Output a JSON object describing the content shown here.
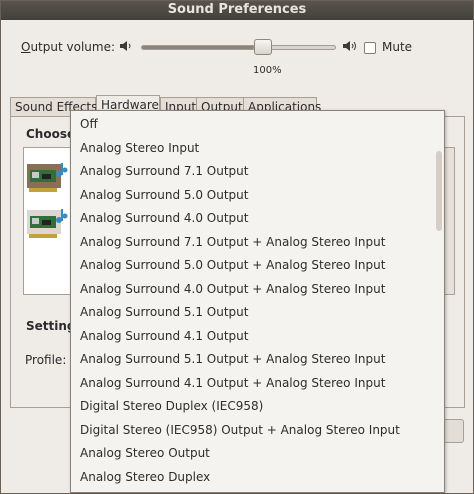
{
  "window": {
    "title": "Sound Preferences"
  },
  "volume": {
    "label_prefix": "",
    "label_mnemonic": "O",
    "label_rest": "utput volume:",
    "level_percent": 100,
    "level_text": "100%",
    "mute_label": "Mute",
    "mute_checked": false
  },
  "tabs": [
    {
      "label": "Sound Effects",
      "active": false
    },
    {
      "label": "Hardware",
      "active": true
    },
    {
      "label": "Input",
      "active": false
    },
    {
      "label": "Output",
      "active": false
    },
    {
      "label": "Applications",
      "active": false
    }
  ],
  "hardware": {
    "choose_title": "Choose",
    "settings_title": "Setting",
    "profile_label": "Profile:"
  },
  "profile_menu": {
    "items": [
      "Off",
      "Analog Stereo Input",
      "Analog Surround 7.1 Output",
      "Analog Surround 5.0 Output",
      "Analog Surround 4.0 Output",
      "Analog Surround 7.1 Output + Analog Stereo Input",
      "Analog Surround 5.0 Output + Analog Stereo Input",
      "Analog Surround 4.0 Output + Analog Stereo Input",
      "Analog Surround 5.1 Output",
      "Analog Surround 4.1 Output",
      "Analog Surround 5.1 Output + Analog Stereo Input",
      "Analog Surround 4.1 Output + Analog Stereo Input",
      "Digital Stereo Duplex (IEC958)",
      "Digital Stereo (IEC958) Output + Analog Stereo Input",
      "Analog Stereo Output",
      "Analog Stereo Duplex"
    ]
  },
  "colors": {
    "window_bg": "#efebe7",
    "titlebar": "#4a4540",
    "menu_bg": "#f5f3f0"
  },
  "icons": [
    "speaker-low-icon",
    "speaker-high-icon",
    "sound-card-icon"
  ]
}
